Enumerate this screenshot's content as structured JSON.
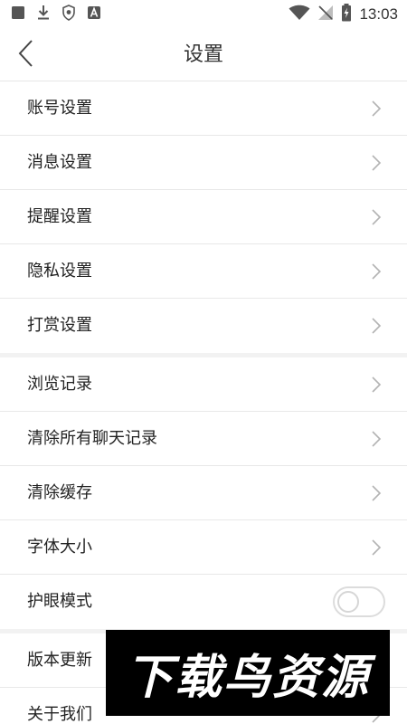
{
  "status_bar": {
    "time": "13:03",
    "icons": [
      "square-notification-icon",
      "download-icon",
      "shield-icon",
      "a-notification-icon",
      "wifi-icon",
      "no-signal-icon",
      "battery-charging-icon"
    ]
  },
  "header": {
    "title": "设置",
    "back_icon": "chevron-left-icon"
  },
  "groups": [
    {
      "items": [
        {
          "label": "账号设置"
        },
        {
          "label": "消息设置"
        },
        {
          "label": "提醒设置"
        },
        {
          "label": "隐私设置"
        },
        {
          "label": "打赏设置"
        }
      ]
    },
    {
      "items": [
        {
          "label": "浏览记录"
        },
        {
          "label": "清除所有聊天记录"
        },
        {
          "label": "清除缓存"
        },
        {
          "label": "字体大小"
        },
        {
          "label": "护眼模式",
          "toggle": false
        }
      ]
    },
    {
      "items": [
        {
          "label": "版本更新"
        },
        {
          "label": "关于我们"
        }
      ]
    }
  ],
  "watermark": {
    "text": "下载鸟资源"
  },
  "colors": {
    "background": "#ffffff",
    "divider": "#e8e8e8",
    "section_gap": "#f2f2f2",
    "chevron": "#b3b3b3",
    "text": "#222222"
  }
}
